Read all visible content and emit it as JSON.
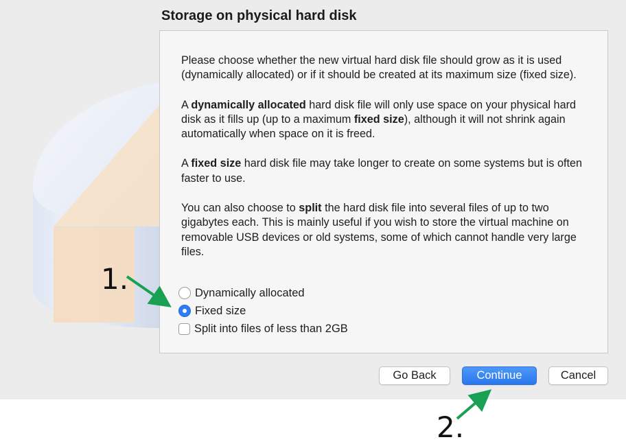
{
  "dialog": {
    "title": "Storage on physical hard disk",
    "paragraphs": {
      "p1": "Please choose whether the new virtual hard disk file should grow as it is used (dynamically allocated) or if it should be created at its maximum size (fixed size).",
      "p2": {
        "t1": "A ",
        "b1": "dynamically allocated",
        "t2": " hard disk file will only use space on your physical hard disk as it fills up (up to a maximum ",
        "b2": "fixed size",
        "t3": "), although it will not shrink again automatically when space on it is freed."
      },
      "p3": {
        "t1": "A ",
        "b1": "fixed size",
        "t2": " hard disk file may take longer to create on some systems but is often faster to use."
      },
      "p4": {
        "t1": "You can also choose to ",
        "b1": "split",
        "t2": " the hard disk file into several files of up to two gigabytes each. This is mainly useful if you wish to store the virtual machine on removable USB devices or old systems, some of which cannot handle very large files."
      }
    },
    "options": {
      "dynamic": {
        "label": "Dynamically allocated",
        "checked": false
      },
      "fixed": {
        "label": "Fixed size",
        "checked": true
      },
      "split": {
        "label": "Split into files of less than 2GB",
        "checked": false
      }
    },
    "buttons": {
      "back": "Go Back",
      "continue": "Continue",
      "cancel": "Cancel"
    }
  },
  "annotations": {
    "step1": "1.",
    "step2": "2."
  },
  "colors": {
    "accent": "#2e7cf6",
    "arrow": "#1aa052",
    "window_bg": "#ececec",
    "panel_bg": "#f6f6f6"
  }
}
